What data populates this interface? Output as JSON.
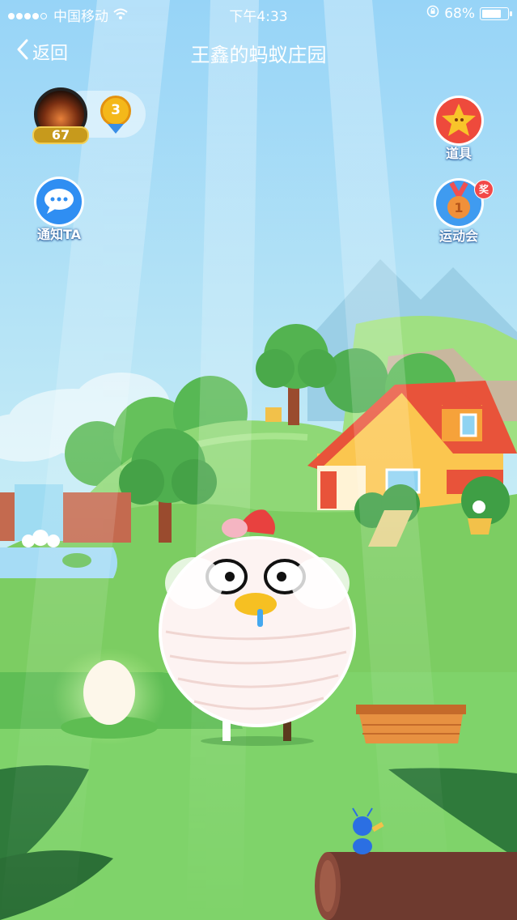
{
  "status_bar": {
    "carrier": "中国移动",
    "time": "下午4:33",
    "battery": "68%",
    "battery_level": 0.68
  },
  "nav": {
    "back_label": "返回",
    "title": "王鑫的蚂蚁庄园"
  },
  "profile": {
    "level": "67",
    "medal": "3"
  },
  "buttons": {
    "notify": "通知TA",
    "props": "道具",
    "sports": "运动会",
    "sports_badge": "奖",
    "sports_rank": "1"
  },
  "colors": {
    "sky": "#a9dcf7",
    "grass": "#7fd36a",
    "roof": "#e8533a",
    "house": "#fbc64f"
  }
}
